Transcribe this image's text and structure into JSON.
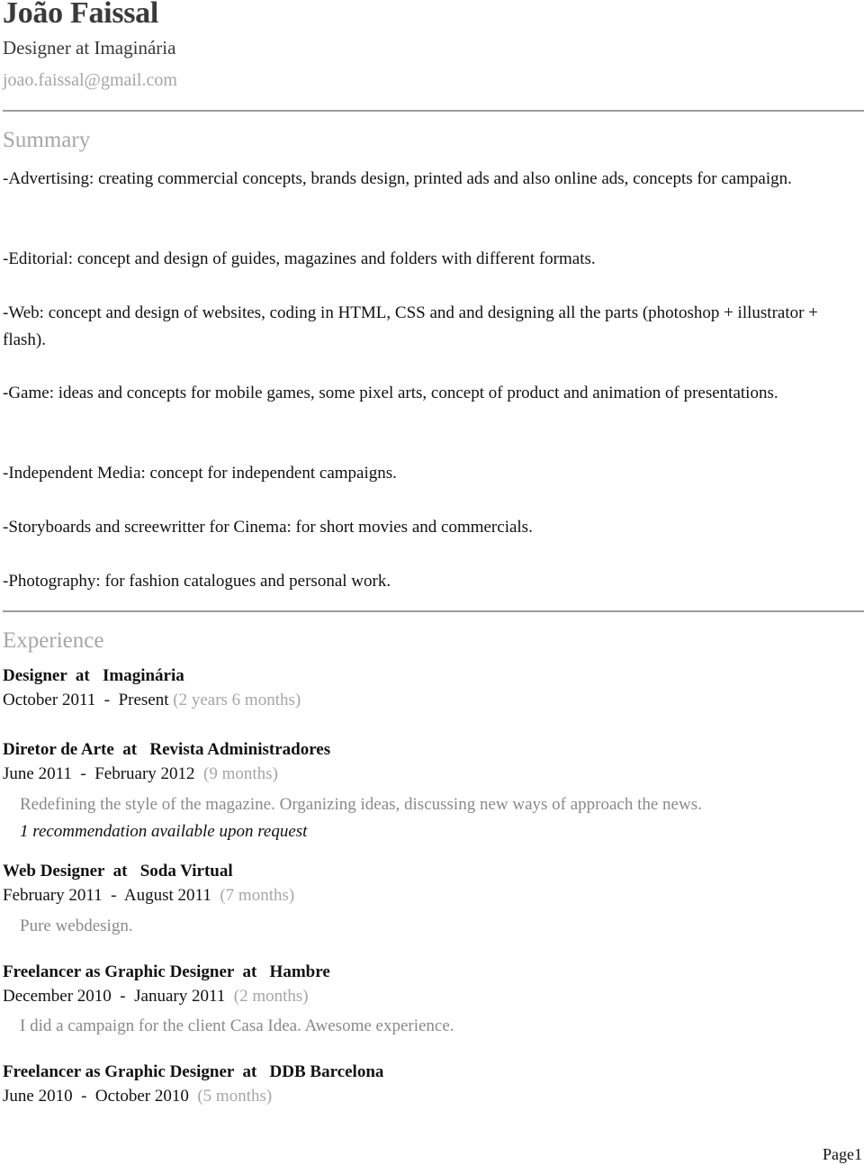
{
  "header": {
    "name": "João Faissal",
    "headline": "Designer at Imaginária",
    "email": "joao.faissal@gmail.com"
  },
  "summary": {
    "title": "Summary",
    "paragraphs": [
      "-Advertising: creating commercial concepts, brands design, printed ads and also online ads, concepts for campaign.",
      "-Editorial: concept and design of guides, magazines and folders with different formats.",
      "-Web: concept and design of websites, coding in HTML, CSS and and designing all the parts (photoshop + illustrator + flash).",
      "-Game: ideas and concepts for mobile games, some pixel arts, concept of product and animation of presentations.",
      "-Independent Media: concept for independent campaigns.",
      "-Storyboards and screewritter for Cinema: for short movies and commercials.",
      "-Photography: for fashion catalogues and personal work."
    ]
  },
  "experience": {
    "title": "Experience",
    "jobs": [
      {
        "title": "Designer  at   Imaginária",
        "dates": "October 2011  -  Present ",
        "duration": "(2 years 6 months)"
      },
      {
        "title": "Diretor de Arte  at   Revista Administradores",
        "dates": "June 2011  -  February 2012  ",
        "duration": "(9 months)",
        "description": "Redefining the style of the magazine. Organizing ideas, discussing new ways of approach the news.",
        "recommendation": "1 recommendation available upon request"
      },
      {
        "title": "Web Designer  at   Soda Virtual",
        "dates": "February 2011  -  August 2011  ",
        "duration": "(7 months)",
        "description": "Pure webdesign."
      },
      {
        "title": "Freelancer as Graphic Designer  at   Hambre",
        "dates": "December 2010  -  January 2011  ",
        "duration": "(2 months)",
        "description": "I did a campaign for the client Casa Idea. Awesome experience."
      },
      {
        "title": "Freelancer as Graphic Designer  at   DDB Barcelona",
        "dates": "June 2010  -  October 2010  ",
        "duration": "(5 months)"
      }
    ]
  },
  "footer": {
    "page_label": "Page1"
  }
}
